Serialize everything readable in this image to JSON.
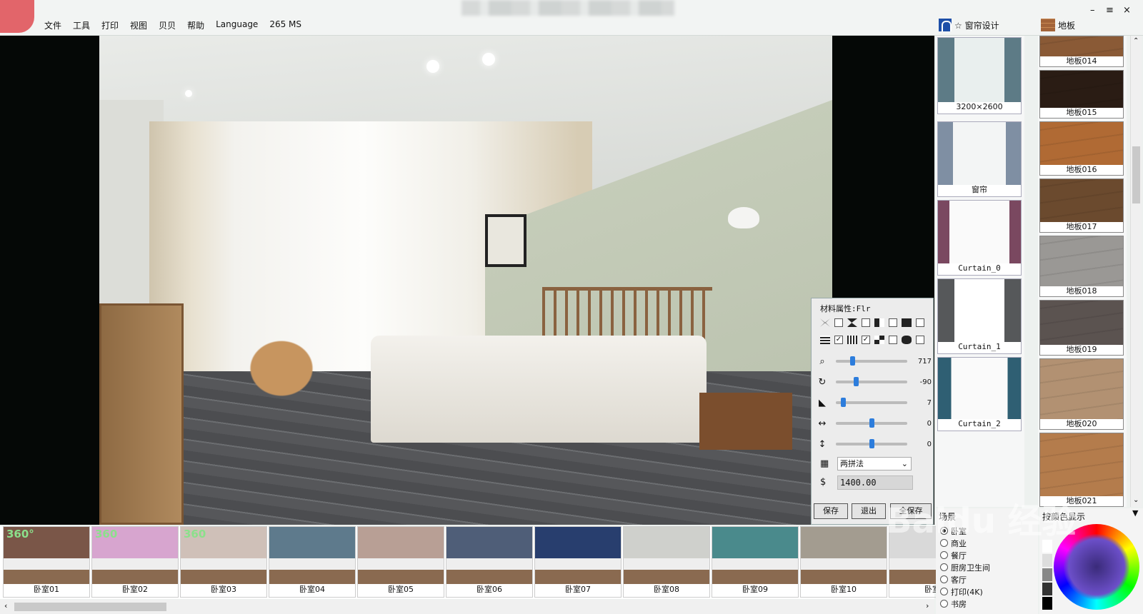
{
  "menu": {
    "items": [
      "文件",
      "工具",
      "打印",
      "视图",
      "贝贝",
      "帮助",
      "Language",
      "265 MS"
    ]
  },
  "window_controls": {
    "minimize": "–",
    "menu": "≡",
    "close": "×"
  },
  "right_tabs": {
    "curtain": "☆ 窗帘设计",
    "floor": "地板"
  },
  "props": {
    "title": "材料属性:Flr",
    "sliders": [
      {
        "icon": "zoom",
        "value": "717",
        "level": 0.22
      },
      {
        "icon": "rotate",
        "value": "-90",
        "level": 0.27
      },
      {
        "icon": "shear",
        "value": "7",
        "level": 0.08
      },
      {
        "icon": "h-move",
        "value": "0",
        "level": 0.5
      },
      {
        "icon": "v-move",
        "value": "0",
        "level": 0.5
      }
    ],
    "pattern": "两拼法",
    "price": "1400.00",
    "buttons": [
      "保存",
      "退出",
      "全保存"
    ]
  },
  "curtains": [
    {
      "label": "3200×2600"
    },
    {
      "label": "窗帘"
    },
    {
      "label": "Curtain_0"
    },
    {
      "label": "Curtain_1"
    },
    {
      "label": "Curtain_2"
    }
  ],
  "floors": [
    {
      "label": "地板014",
      "color": "#8a5a36"
    },
    {
      "label": "地板015",
      "color": "#2a1c14"
    },
    {
      "label": "地板016",
      "color": "#b06a34"
    },
    {
      "label": "地板017",
      "color": "#6b4a2e"
    },
    {
      "label": "地板018",
      "color": "#9a9895"
    },
    {
      "label": "地板019",
      "color": "#5b5350"
    },
    {
      "label": "地板020",
      "color": "#b29172"
    },
    {
      "label": "地板021",
      "color": "#b47c4c"
    }
  ],
  "thumbnails": [
    {
      "label": "卧室01",
      "badge": "360°",
      "color": "#7a5648"
    },
    {
      "label": "卧室02",
      "badge": "360",
      "color": "#d7a5cf"
    },
    {
      "label": "卧室03",
      "badge": "360",
      "color": "#cfc0b8"
    },
    {
      "label": "卧室04",
      "badge": "",
      "color": "#5e7a8c"
    },
    {
      "label": "卧室05",
      "badge": "",
      "color": "#b89f95"
    },
    {
      "label": "卧室06",
      "badge": "",
      "color": "#4f5e78"
    },
    {
      "label": "卧室07",
      "badge": "",
      "color": "#283e6e"
    },
    {
      "label": "卧室08",
      "badge": "",
      "color": "#cfd0cc"
    },
    {
      "label": "卧室09",
      "badge": "",
      "color": "#4a8a8c"
    },
    {
      "label": "卧室10",
      "badge": "",
      "color": "#a39c90"
    },
    {
      "label": "卧室",
      "badge": "",
      "color": "#d9d9d9"
    }
  ],
  "scene": {
    "title": "场景",
    "options": [
      "卧室",
      "商业",
      "餐厅",
      "厨房卫生间",
      "客厅",
      "打印(4K)",
      "书房"
    ],
    "selected": 0
  },
  "color_panel": {
    "title": "按颜色显示"
  },
  "watermark": "Baidu 经验"
}
